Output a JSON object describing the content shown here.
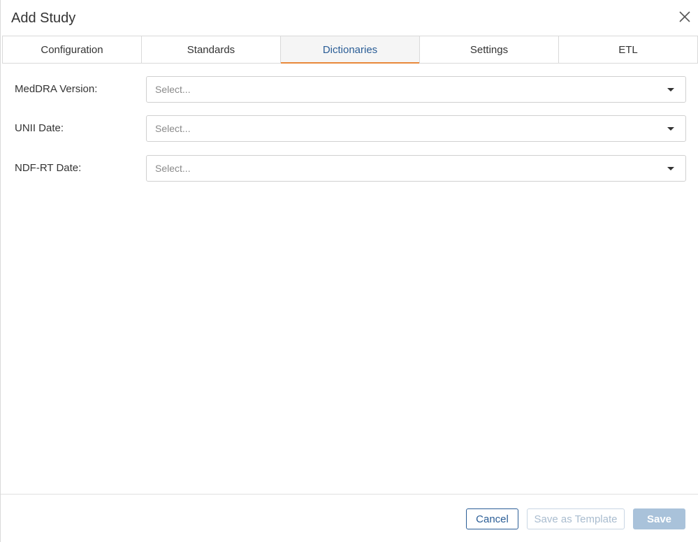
{
  "dialog": {
    "title": "Add Study"
  },
  "tabs": [
    {
      "label": "Configuration",
      "active": false
    },
    {
      "label": "Standards",
      "active": false
    },
    {
      "label": "Dictionaries",
      "active": true
    },
    {
      "label": "Settings",
      "active": false
    },
    {
      "label": "ETL",
      "active": false
    }
  ],
  "form": {
    "fields": [
      {
        "label": "MedDRA Version:",
        "placeholder": "Select..."
      },
      {
        "label": "UNII Date:",
        "placeholder": "Select..."
      },
      {
        "label": "NDF-RT Date:",
        "placeholder": "Select..."
      }
    ]
  },
  "footer": {
    "cancel_label": "Cancel",
    "save_template_label": "Save as Template",
    "save_label": "Save"
  },
  "colors": {
    "accent": "#2a5d96",
    "active_tab_underline": "#e8883a",
    "disabled_button": "#a9c2da"
  }
}
